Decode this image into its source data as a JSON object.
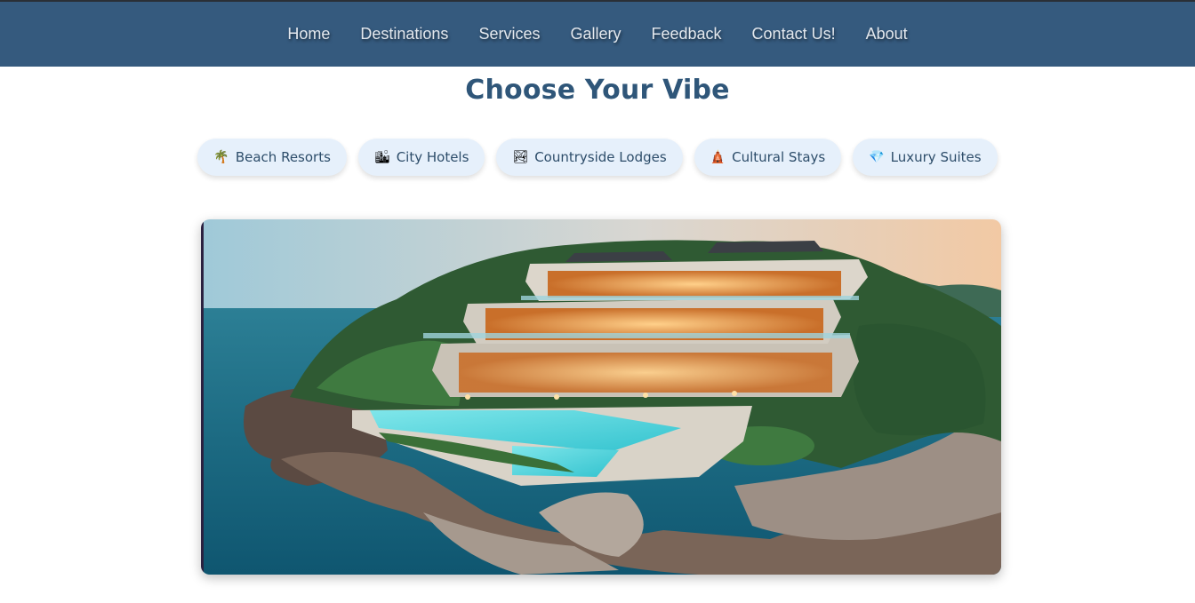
{
  "nav": {
    "items": [
      {
        "label": "Home"
      },
      {
        "label": "Destinations"
      },
      {
        "label": "Services"
      },
      {
        "label": "Gallery"
      },
      {
        "label": "Feedback"
      },
      {
        "label": "Contact Us!"
      },
      {
        "label": "About"
      }
    ]
  },
  "main": {
    "title": "Choose Your Vibe",
    "vibes": [
      {
        "icon": "palm-tree-icon",
        "glyph": "🌴",
        "label": "Beach Resorts"
      },
      {
        "icon": "city-icon",
        "glyph": "🏙",
        "label": "City Hotels"
      },
      {
        "icon": "countryside-icon",
        "glyph": "🏞",
        "label": "Countryside Lodges"
      },
      {
        "icon": "temple-icon",
        "glyph": "🛕",
        "label": "Cultural Stays"
      },
      {
        "icon": "diamond-icon",
        "glyph": "💎",
        "label": "Luxury Suites"
      }
    ]
  },
  "colors": {
    "navbar": "#355a7e",
    "title": "#2f5679",
    "pill_bg": "#e6f0fb",
    "pill_text": "#2d4d6a"
  }
}
